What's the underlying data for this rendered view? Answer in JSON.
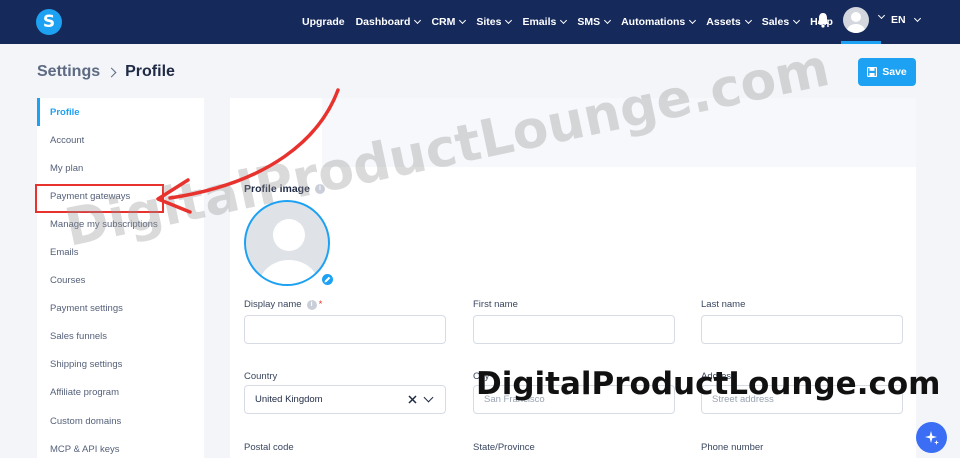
{
  "brand": {
    "logo_letter": "S",
    "accent": "#1da1f2",
    "nav_bg": "#15295b"
  },
  "nav": {
    "items": [
      {
        "label": "Upgrade",
        "dropdown": false
      },
      {
        "label": "Dashboard",
        "dropdown": true
      },
      {
        "label": "CRM",
        "dropdown": true
      },
      {
        "label": "Sites",
        "dropdown": true
      },
      {
        "label": "Emails",
        "dropdown": true
      },
      {
        "label": "SMS",
        "dropdown": true
      },
      {
        "label": "Automations",
        "dropdown": true
      },
      {
        "label": "Assets",
        "dropdown": true
      },
      {
        "label": "Sales",
        "dropdown": true
      },
      {
        "label": "Help",
        "dropdown": false
      }
    ],
    "notifications_icon": "bell-icon",
    "language": "EN"
  },
  "header": {
    "breadcrumb_parent": "Settings",
    "breadcrumb_current": "Profile",
    "save_label": "Save"
  },
  "sidebar": {
    "items": [
      {
        "label": "Profile",
        "active": true
      },
      {
        "label": "Account"
      },
      {
        "label": "My plan"
      },
      {
        "label": "Payment gateways"
      },
      {
        "label": "Manage my subscriptions"
      },
      {
        "label": "Emails"
      },
      {
        "label": "Courses"
      },
      {
        "label": "Payment settings"
      },
      {
        "label": "Sales funnels"
      },
      {
        "label": "Shipping settings"
      },
      {
        "label": "Affiliate program"
      },
      {
        "label": "Custom domains"
      },
      {
        "label": "MCP & API keys"
      }
    ]
  },
  "form": {
    "profile_image_label": "Profile image",
    "display_name_label": "Display name",
    "first_name_label": "First name",
    "last_name_label": "Last name",
    "country_label": "Country",
    "country_value": "United Kingdom",
    "city_label": "City",
    "city_placeholder": "San Francisco",
    "address_label": "Address",
    "address_placeholder": "Street address",
    "postal_code_label": "Postal code",
    "state_label": "State/Province",
    "phone_label": "Phone number"
  },
  "watermark": {
    "diagonal": "DigitalProductLounge.com",
    "bottom": "DigitalProductLounge.com"
  },
  "annotation_color": "#e8322e"
}
